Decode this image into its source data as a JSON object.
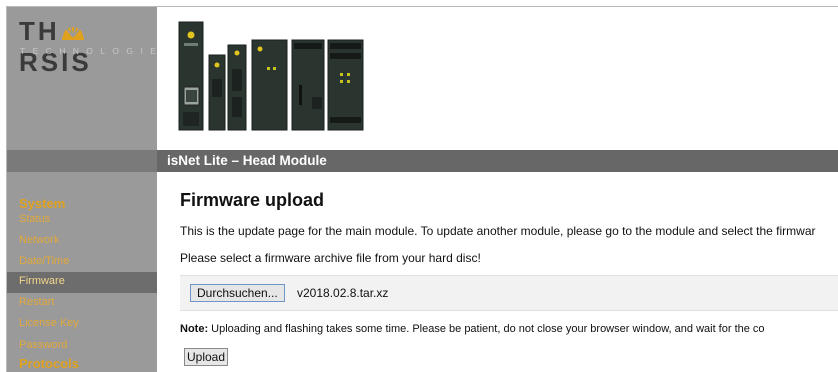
{
  "brand": {
    "logo_part1": "TH",
    "logo_part2": "RSIS",
    "tagline": "TECHNOLOGIES",
    "accent": "#e0a21e"
  },
  "header": {
    "title": "isNet Lite – Head Module"
  },
  "sidebar": {
    "sections": [
      {
        "heading": "System",
        "items": [
          {
            "label": "Status",
            "active": false
          },
          {
            "label": "Network",
            "active": false
          },
          {
            "label": "Date/Time",
            "active": false
          },
          {
            "label": "Firmware",
            "active": true
          },
          {
            "label": "Restart",
            "active": false
          },
          {
            "label": "License Key",
            "active": false
          },
          {
            "label": "Password",
            "active": false
          }
        ]
      },
      {
        "heading": "Protocols",
        "items": []
      }
    ]
  },
  "main": {
    "title": "Firmware upload",
    "description": "This is the update page for the main module. To update another module, please go to the module and select the firmwar",
    "instruction": "Please select a firmware archive file from your hard disc!",
    "browse_label": "Durchsuchen...",
    "filename": "v2018.02.8.tar.xz",
    "note_label": "Note:",
    "note_text": " Uploading and flashing takes some time. Please be patient, do not close your browser window, and wait for the co",
    "upload_label": "Upload"
  }
}
